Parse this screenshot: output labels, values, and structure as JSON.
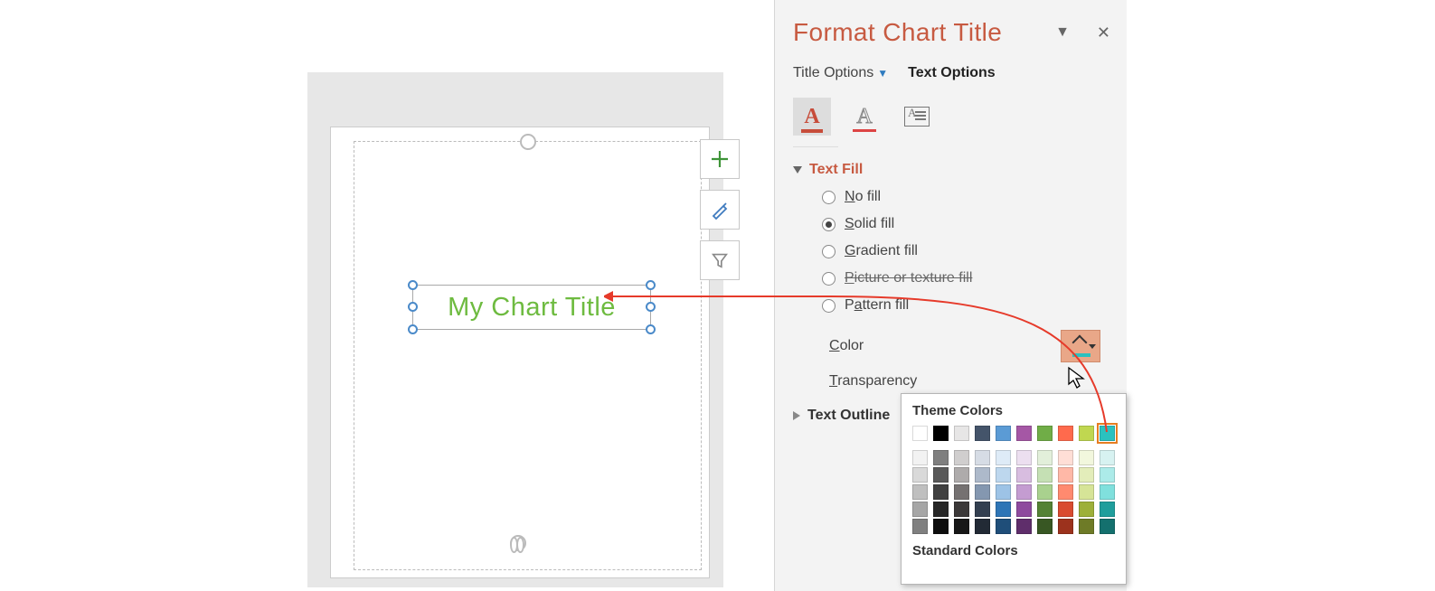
{
  "canvas": {
    "chart_title": "My Chart Title"
  },
  "floatButtons": {
    "add": "+",
    "brush": "🖌",
    "filter": "▾"
  },
  "pane": {
    "title": "Format Chart Title",
    "tabs": {
      "titleOptions": "Title Options",
      "textOptions": "Text Options"
    },
    "sections": {
      "textFill": "Text Fill",
      "textOutline": "Text Outline"
    },
    "fill": {
      "noFill": "No fill",
      "solidFill": "Solid fill",
      "gradientFill": "Gradient fill",
      "pictureFill": "Picture or texture fill",
      "patternFill": "Pattern fill",
      "colorLabel": "Color",
      "transparencyLabel": "Transparency"
    }
  },
  "colorPopup": {
    "themeHeader": "Theme Colors",
    "standardHeader": "Standard Colors",
    "themeRow": [
      "#ffffff",
      "#000000",
      "#e7e6e6",
      "#44546a",
      "#5b9bd5",
      "#a557a5",
      "#70ad47",
      "#ff6a4d",
      "#c0d750",
      "#2bc1bf"
    ],
    "shadeColumns": [
      [
        "#f2f2f2",
        "#d9d9d9",
        "#bfbfbf",
        "#a6a6a6",
        "#808080"
      ],
      [
        "#7f7f7f",
        "#595959",
        "#404040",
        "#262626",
        "#0d0d0d"
      ],
      [
        "#d0cece",
        "#aeabab",
        "#757171",
        "#3b3838",
        "#171717"
      ],
      [
        "#d6dce5",
        "#adb9ca",
        "#8497b0",
        "#333f50",
        "#222a35"
      ],
      [
        "#deebf7",
        "#bdd7ee",
        "#9dc3e6",
        "#2e75b6",
        "#1f4e79"
      ],
      [
        "#ecdff0",
        "#d8bde0",
        "#c49cd1",
        "#8e4a9e",
        "#5f2e6b"
      ],
      [
        "#e2efda",
        "#c5e0b4",
        "#a9d18e",
        "#548235",
        "#385723"
      ],
      [
        "#ffded6",
        "#ffb8a7",
        "#ff8a6f",
        "#d94b30",
        "#9c321d"
      ],
      [
        "#f2f7dd",
        "#e3edba",
        "#d6e497",
        "#9db03a",
        "#6e7b27"
      ],
      [
        "#d7f2f1",
        "#acebe9",
        "#80e0dd",
        "#1f9e9c",
        "#14706e"
      ]
    ],
    "selectedIndex": 9
  }
}
